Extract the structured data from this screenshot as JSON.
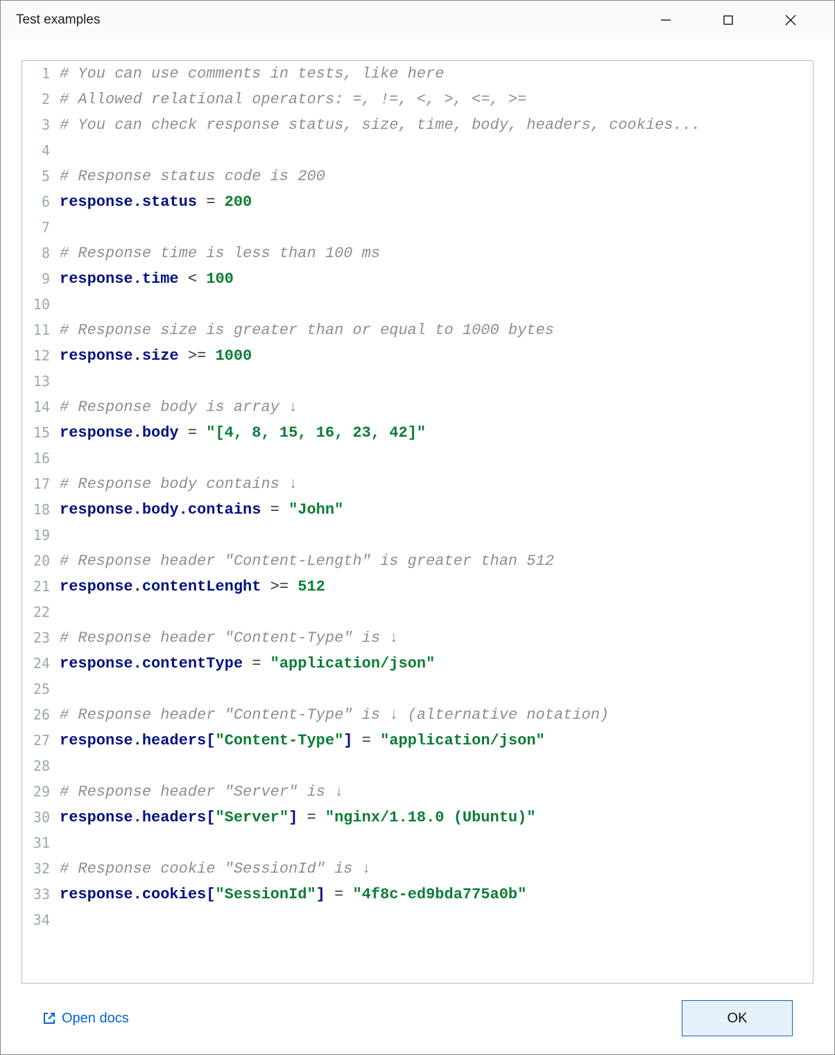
{
  "window": {
    "title": "Test examples"
  },
  "code": {
    "lines": [
      {
        "n": 1,
        "tokens": [
          {
            "t": "comment",
            "v": "# You can use comments in tests, like here"
          }
        ]
      },
      {
        "n": 2,
        "tokens": [
          {
            "t": "comment",
            "v": "# Allowed relational operators: =, !=, <, >, <=, >="
          }
        ]
      },
      {
        "n": 3,
        "tokens": [
          {
            "t": "comment",
            "v": "# You can check response status, size, time, body, headers, cookies..."
          }
        ]
      },
      {
        "n": 4,
        "tokens": []
      },
      {
        "n": 5,
        "tokens": [
          {
            "t": "comment",
            "v": "# Response status code is 200"
          }
        ]
      },
      {
        "n": 6,
        "tokens": [
          {
            "t": "ident",
            "v": "response.status"
          },
          {
            "t": "op",
            "v": " = "
          },
          {
            "t": "num",
            "v": "200"
          }
        ]
      },
      {
        "n": 7,
        "tokens": []
      },
      {
        "n": 8,
        "tokens": [
          {
            "t": "comment",
            "v": "# Response time is less than 100 ms"
          }
        ]
      },
      {
        "n": 9,
        "tokens": [
          {
            "t": "ident",
            "v": "response.time"
          },
          {
            "t": "op",
            "v": " < "
          },
          {
            "t": "num",
            "v": "100"
          }
        ]
      },
      {
        "n": 10,
        "tokens": []
      },
      {
        "n": 11,
        "tokens": [
          {
            "t": "comment",
            "v": "# Response size is greater than or equal to 1000 bytes"
          }
        ]
      },
      {
        "n": 12,
        "tokens": [
          {
            "t": "ident",
            "v": "response.size"
          },
          {
            "t": "op",
            "v": " >= "
          },
          {
            "t": "num",
            "v": "1000"
          }
        ]
      },
      {
        "n": 13,
        "tokens": []
      },
      {
        "n": 14,
        "tokens": [
          {
            "t": "comment",
            "v": "# Response body is array ↓"
          }
        ]
      },
      {
        "n": 15,
        "tokens": [
          {
            "t": "ident",
            "v": "response.body"
          },
          {
            "t": "op",
            "v": " = "
          },
          {
            "t": "str",
            "v": "\"[4, 8, 15, 16, 23, 42]\""
          }
        ]
      },
      {
        "n": 16,
        "tokens": []
      },
      {
        "n": 17,
        "tokens": [
          {
            "t": "comment",
            "v": "# Response body contains ↓"
          }
        ]
      },
      {
        "n": 18,
        "tokens": [
          {
            "t": "ident",
            "v": "response.body.contains"
          },
          {
            "t": "op",
            "v": " = "
          },
          {
            "t": "str",
            "v": "\"John\""
          }
        ]
      },
      {
        "n": 19,
        "tokens": []
      },
      {
        "n": 20,
        "tokens": [
          {
            "t": "comment",
            "v": "# Response header \"Content-Length\" is greater than 512"
          }
        ]
      },
      {
        "n": 21,
        "tokens": [
          {
            "t": "ident",
            "v": "response.contentLenght"
          },
          {
            "t": "op",
            "v": " >= "
          },
          {
            "t": "num",
            "v": "512"
          }
        ]
      },
      {
        "n": 22,
        "tokens": []
      },
      {
        "n": 23,
        "tokens": [
          {
            "t": "comment",
            "v": "# Response header \"Content-Type\" is ↓"
          }
        ]
      },
      {
        "n": 24,
        "tokens": [
          {
            "t": "ident",
            "v": "response.contentType"
          },
          {
            "t": "op",
            "v": " = "
          },
          {
            "t": "str",
            "v": "\"application/json\""
          }
        ]
      },
      {
        "n": 25,
        "tokens": []
      },
      {
        "n": 26,
        "tokens": [
          {
            "t": "comment",
            "v": "# Response header \"Content-Type\" is ↓ (alternative notation)"
          }
        ]
      },
      {
        "n": 27,
        "tokens": [
          {
            "t": "ident",
            "v": "response.headers["
          },
          {
            "t": "str",
            "v": "\"Content-Type\""
          },
          {
            "t": "ident",
            "v": "]"
          },
          {
            "t": "op",
            "v": " = "
          },
          {
            "t": "str",
            "v": "\"application/json\""
          }
        ]
      },
      {
        "n": 28,
        "tokens": []
      },
      {
        "n": 29,
        "tokens": [
          {
            "t": "comment",
            "v": "# Response header \"Server\" is ↓"
          }
        ]
      },
      {
        "n": 30,
        "tokens": [
          {
            "t": "ident",
            "v": "response.headers["
          },
          {
            "t": "str",
            "v": "\"Server\""
          },
          {
            "t": "ident",
            "v": "]"
          },
          {
            "t": "op",
            "v": " = "
          },
          {
            "t": "str",
            "v": "\"nginx/1.18.0 (Ubuntu)\""
          }
        ]
      },
      {
        "n": 31,
        "tokens": []
      },
      {
        "n": 32,
        "tokens": [
          {
            "t": "comment",
            "v": "# Response cookie \"SessionId\" is ↓"
          }
        ]
      },
      {
        "n": 33,
        "tokens": [
          {
            "t": "ident",
            "v": "response.cookies["
          },
          {
            "t": "str",
            "v": "\"SessionId\""
          },
          {
            "t": "ident",
            "v": "]"
          },
          {
            "t": "op",
            "v": " = "
          },
          {
            "t": "str",
            "v": "\"4f8c-ed9bda775a0b\""
          }
        ]
      },
      {
        "n": 34,
        "tokens": []
      }
    ]
  },
  "footer": {
    "open_docs_label": "Open docs",
    "ok_label": "OK"
  }
}
